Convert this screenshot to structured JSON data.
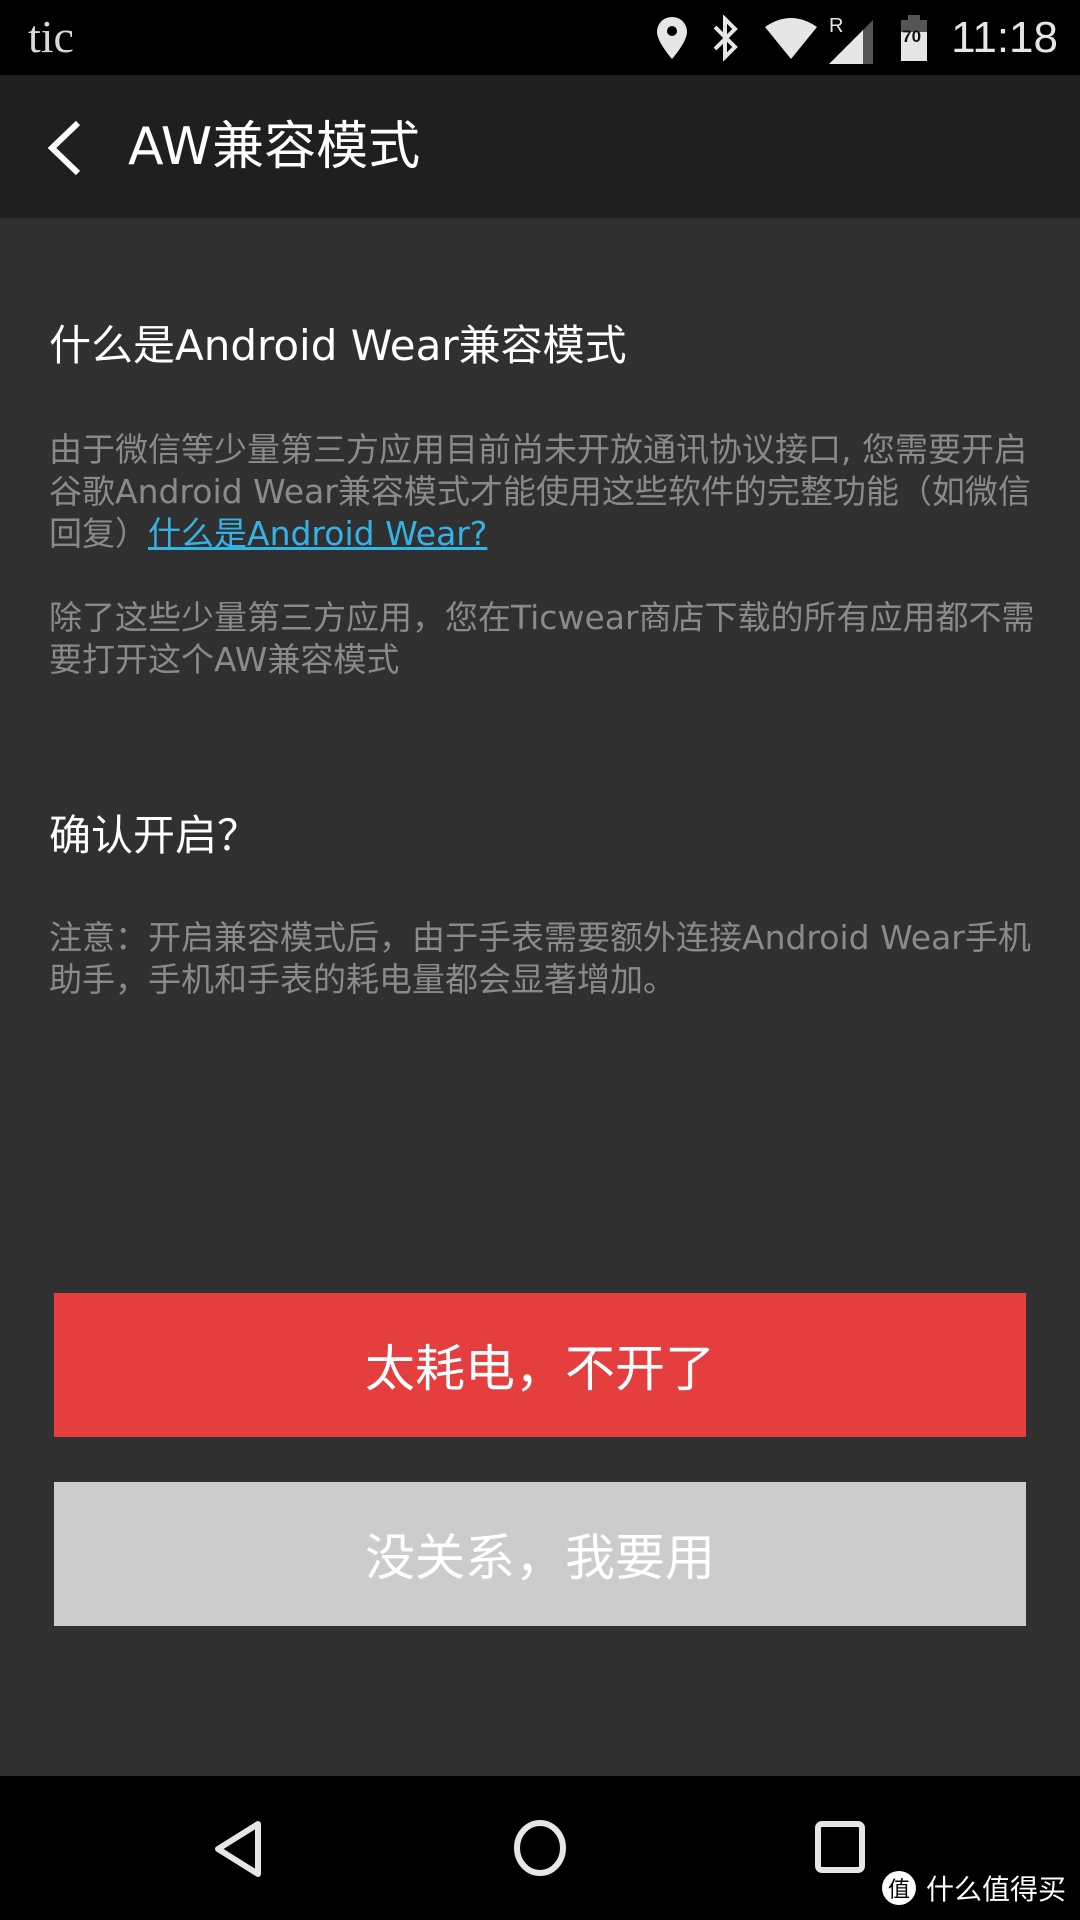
{
  "status_bar": {
    "app_label": "tic",
    "icons": [
      "location-icon",
      "bluetooth-icon",
      "wifi-icon",
      "cellular-roaming-icon",
      "battery-icon"
    ],
    "roaming_label": "R",
    "battery_level": "70",
    "time": "11:18"
  },
  "toolbar": {
    "back_icon": "chevron-left-icon",
    "title": "AW兼容模式"
  },
  "section1": {
    "heading": "什么是Android Wear兼容模式",
    "paragraph1": "由于微信等少量第三方应用目前尚未开放通讯协议接口, 您需要开启谷歌Android Wear兼容模式才能使用这些软件的完整功能（如微信回复）",
    "link": "什么是Android Wear?",
    "paragraph2": "除了这些少量第三方应用，您在Ticwear商店下载的所有应用都不需要打开这个AW兼容模式"
  },
  "section2": {
    "heading": "确认开启？",
    "note": "注意：开启兼容模式后，由于手表需要额外连接Android Wear手机助手，手机和手表的耗电量都会显著增加。"
  },
  "buttons": {
    "decline": "太耗电，不开了",
    "accept": "没关系，我要用"
  },
  "colors": {
    "decline_bg": "#e53e3f",
    "accept_bg": "#cccccc",
    "link": "#35b2e6"
  },
  "nav_bar": {
    "icons": [
      "back-triangle-icon",
      "home-circle-icon",
      "recents-square-icon"
    ]
  },
  "watermark": {
    "badge": "值",
    "text": "什么值得买"
  }
}
